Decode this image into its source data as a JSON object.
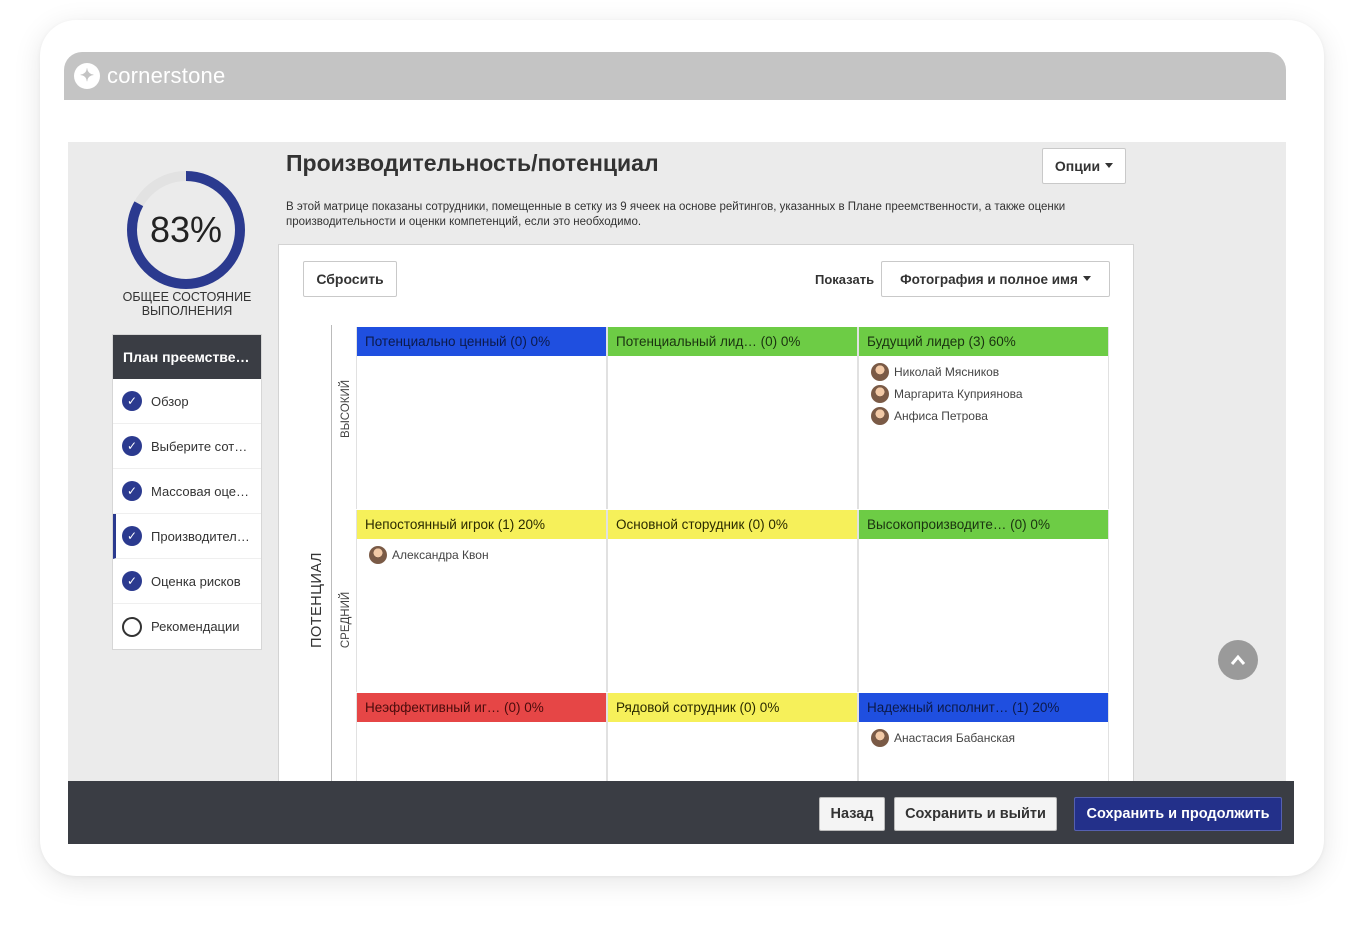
{
  "app": {
    "brand": "cornerstone"
  },
  "sidebar": {
    "progress_value": "83%",
    "progress_fraction": 0.83,
    "progress_caption": "Общее состояние выполнения",
    "steps_header": "План преемстве…",
    "steps": [
      {
        "label": "Обзор",
        "done": true
      },
      {
        "label": "Выберите сот…",
        "done": true
      },
      {
        "label": "Массовая оце…",
        "done": true
      },
      {
        "label": "Производител…",
        "done": true,
        "active": true
      },
      {
        "label": "Оценка рисков",
        "done": true
      },
      {
        "label": "Рекомендации",
        "done": false
      }
    ]
  },
  "header": {
    "title": "Производительность/потенциал",
    "options_label": "Опции",
    "description": "В этой матрице показаны сотрудники, помещенные в сетку из 9 ячеек на основе рейтингов, указанных в Плане преемственности, а также оценки производительности и оценки компетенций, если это необходимо."
  },
  "panel": {
    "reset_label": "Сбросить",
    "show_label": "Показать",
    "show_value": "Фотография и полное имя",
    "axis_title": "Потенциал",
    "row_labels": [
      "Высокий",
      "Средний"
    ],
    "cells": [
      {
        "title": "Потенциально ценный (0) 0%",
        "color": "#1f4fe0",
        "tone": "blue",
        "people": []
      },
      {
        "title": "Потенциальный лид…  (0) 0%",
        "color": "#6dcc45",
        "tone": "green",
        "people": []
      },
      {
        "title": "Будущий лидер (3) 60%",
        "color": "#6dcc45",
        "tone": "green",
        "people": [
          "Николай Мясников",
          "Маргарита Куприянова",
          "Анфиса Петрова"
        ]
      },
      {
        "title": "Непостоянный игрок (1) 20%",
        "color": "#f6f05a",
        "tone": "yellow",
        "people": [
          "Александра Квон"
        ]
      },
      {
        "title": "Основной сторудник (0) 0%",
        "color": "#f6f05a",
        "tone": "yellow",
        "people": []
      },
      {
        "title": "Высокопроизводите…  (0) 0%",
        "color": "#6dcc45",
        "tone": "green",
        "people": []
      },
      {
        "title": "Неэффективный иг…   (0) 0%",
        "color": "#e64646",
        "tone": "red",
        "people": []
      },
      {
        "title": "Рядовой сотрудник (0) 0%",
        "color": "#f6f05a",
        "tone": "yellow",
        "people": []
      },
      {
        "title": "Надежный исполнит…  (1) 20%",
        "color": "#1f4fe0",
        "tone": "blue",
        "people": [
          "Анастасия Бабанская"
        ]
      }
    ]
  },
  "footer": {
    "back_label": "Назад",
    "save_exit_label": "Сохранить и выйти",
    "save_continue_label": "Сохранить и продолжить"
  },
  "icons": {
    "brand": "cornerstone-logo-icon",
    "step_done": "check-circle-icon",
    "step_pending": "empty-circle-icon",
    "dropdown": "caret-down-icon",
    "scroll": "chevron-up-icon"
  },
  "colors": {
    "accent": "#2b3a8f",
    "primary_button": "#23308a",
    "dark_bar": "#3a3d44"
  }
}
